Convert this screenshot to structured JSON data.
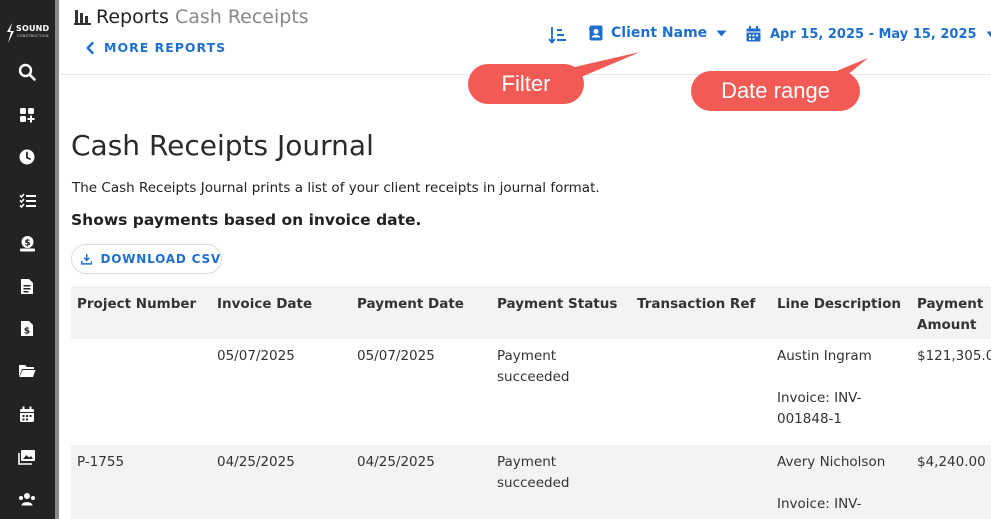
{
  "header": {
    "title": "Reports",
    "subtitle": "Cash Receipts",
    "more_reports": "MORE REPORTS",
    "client_filter": "Client Name",
    "date_range": "Apr 15, 2025 - May 15, 2025"
  },
  "annotations": {
    "filter": "Filter",
    "date_range": "Date range"
  },
  "logo": {
    "name": "SOUND",
    "sub": "CONSTRUCTION"
  },
  "sidebar": {
    "icons": [
      "search-icon",
      "dashboard-icon",
      "clock-icon",
      "checklist-icon",
      "money-icon",
      "document-icon",
      "invoice-icon",
      "folder-icon",
      "calendar-icon",
      "photos-icon",
      "people-icon"
    ]
  },
  "main": {
    "heading": "Cash Receipts Journal",
    "description": "The Cash Receipts Journal prints a list of your client receipts in journal format.",
    "subheading": "Shows payments based on invoice date.",
    "download_csv": "DOWNLOAD CSV"
  },
  "table": {
    "headers": [
      "Project Number",
      "Invoice Date",
      "Payment Date",
      "Payment Status",
      "Transaction Ref",
      "Line Description",
      "Payment Amount"
    ],
    "rows": [
      {
        "project_number": "",
        "invoice_date": "05/07/2025",
        "payment_date": "05/07/2025",
        "payment_status": "Payment succeeded",
        "transaction_ref": "",
        "line_client": "Austin Ingram",
        "line_invoice": "Invoice: INV-001848-1",
        "amount": "$121,305.0"
      },
      {
        "project_number": "P-1755",
        "invoice_date": "04/25/2025",
        "payment_date": "04/25/2025",
        "payment_status": "Payment succeeded",
        "transaction_ref": "",
        "line_client": "Avery Nicholson",
        "line_invoice": "Invoice: INV-",
        "amount": "$4,240.00"
      }
    ]
  },
  "colors": {
    "accent": "#1e6fd0",
    "sidebar": "#232323",
    "annotation": "#f25b55"
  }
}
